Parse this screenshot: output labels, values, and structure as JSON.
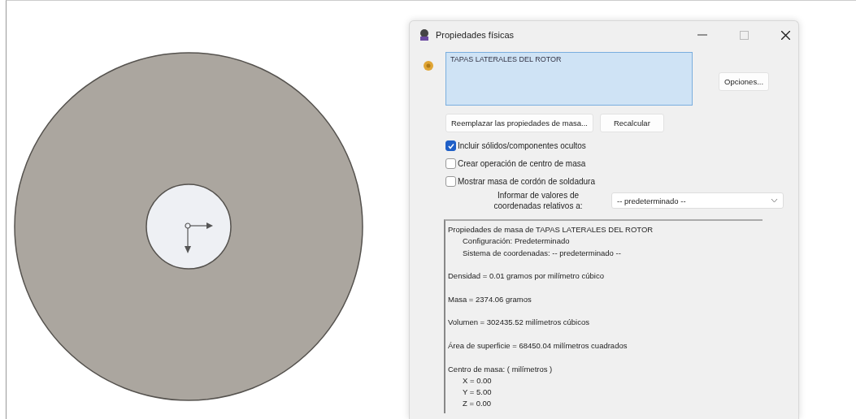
{
  "window": {
    "title": "Propiedades físicas"
  },
  "selection": {
    "items": [
      "TAPAS LATERALES DEL ROTOR"
    ]
  },
  "buttons": {
    "options": "Opciones...",
    "replace": "Reemplazar las propiedades de masa...",
    "recalculate": "Recalcular"
  },
  "options": [
    {
      "label": "Incluir sólidos/componentes ocultos",
      "checked": true
    },
    {
      "label": "Crear operación de centro de masa",
      "checked": false
    },
    {
      "label": "Mostrar masa de cordón de soldadura",
      "checked": false
    }
  ],
  "coordinates": {
    "label": "Informar de valores de coordenadas relativos a:",
    "value": "-- predeterminado --"
  },
  "results": [
    {
      "text": "Propiedades de masa de TAPAS LATERALES DEL ROTOR",
      "details": [
        "Configuración: Predeterminado",
        "Sistema de coordenadas: -- predeterminado --"
      ]
    },
    {
      "text": "Densidad = 0.01 gramos por milímetro cúbico"
    },
    {
      "text": "Masa = 2374.06 gramos"
    },
    {
      "text": "Volumen = 302435.52 milímetros cúbicos"
    },
    {
      "text": "Área de superficie = 68450.04  milímetros cuadrados"
    },
    {
      "text": "Centro de masa: ( milímetros )",
      "details": [
        "X = 0.00",
        "Y = 5.00",
        "Z = 0.00"
      ]
    }
  ]
}
